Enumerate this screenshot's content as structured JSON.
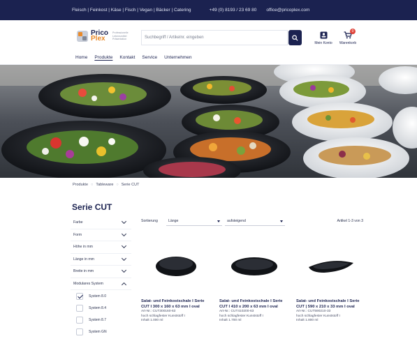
{
  "topbar": {
    "categories": "Fleisch | Feinkost | Käse | Fisch | Vegan | Bäcker | Catering",
    "phone": "+49 (0) 8193 / 23 69 80",
    "email": "office@pricoplex.com"
  },
  "header": {
    "logo_line1": "Prico",
    "logo_line2": "Plex",
    "logo_tagline": "Professionelle Lebensmittel Präsentation",
    "search_placeholder": "Suchbegriff / Artikelnr. eingeben",
    "account_label": "Mein Konto",
    "cart_label": "Warenkorb",
    "cart_count": "0"
  },
  "nav": {
    "items": [
      "Home",
      "Produkte",
      "Kontakt",
      "Service",
      "Unternehmen"
    ],
    "active": "Produkte"
  },
  "breadcrumb": [
    "Produkte",
    "Tableware",
    "Serie CUT"
  ],
  "page_title": "Serie CUT",
  "filters": {
    "groups": [
      "Farbe",
      "Form",
      "Höhe in mm",
      "Länge in mm",
      "Breite in mm",
      "Modulares System"
    ],
    "expanded": "Modulares System",
    "options": [
      {
        "label": "System 8.0",
        "checked": true
      },
      {
        "label": "System 8.4",
        "checked": false
      },
      {
        "label": "System 8.7",
        "checked": false
      },
      {
        "label": "System GN",
        "checked": false
      }
    ]
  },
  "toolbar": {
    "sort_label": "Sortierung",
    "sort_field": "Länge",
    "sort_order": "aufsteigend",
    "count_text": "Artikel 1-3 von 3"
  },
  "products": [
    {
      "title": "Salat- und Feinkostschale I Serie CUT I 300 x 160 x 63 mm I oval",
      "article": "Art-Nr.: CUT300160-63",
      "material": "hoch schlagfester Kunststoff I",
      "content": "Inhalt 1.000 ml"
    },
    {
      "title": "Salat- und Feinkostschale I Serie CUT I 410 x 200 x 63 mm I oval",
      "article": "Art-Nr.: CUT410200-63",
      "material": "hoch schlagfester Kunststoff I",
      "content": "Inhalt 1.700 ml"
    },
    {
      "title": "Salat- und Feinkostschale I Serie CUT | 590 x 210 x 33 mm I oval",
      "article": "Art-Nr.: CUT590210-33",
      "material": "hoch schlagfester Kunststoff I",
      "content": "Inhalt 1.800 ml"
    }
  ],
  "colors": {
    "brand_navy": "#1b2250",
    "brand_orange": "#e98a2a",
    "badge_red": "#e0443a"
  }
}
